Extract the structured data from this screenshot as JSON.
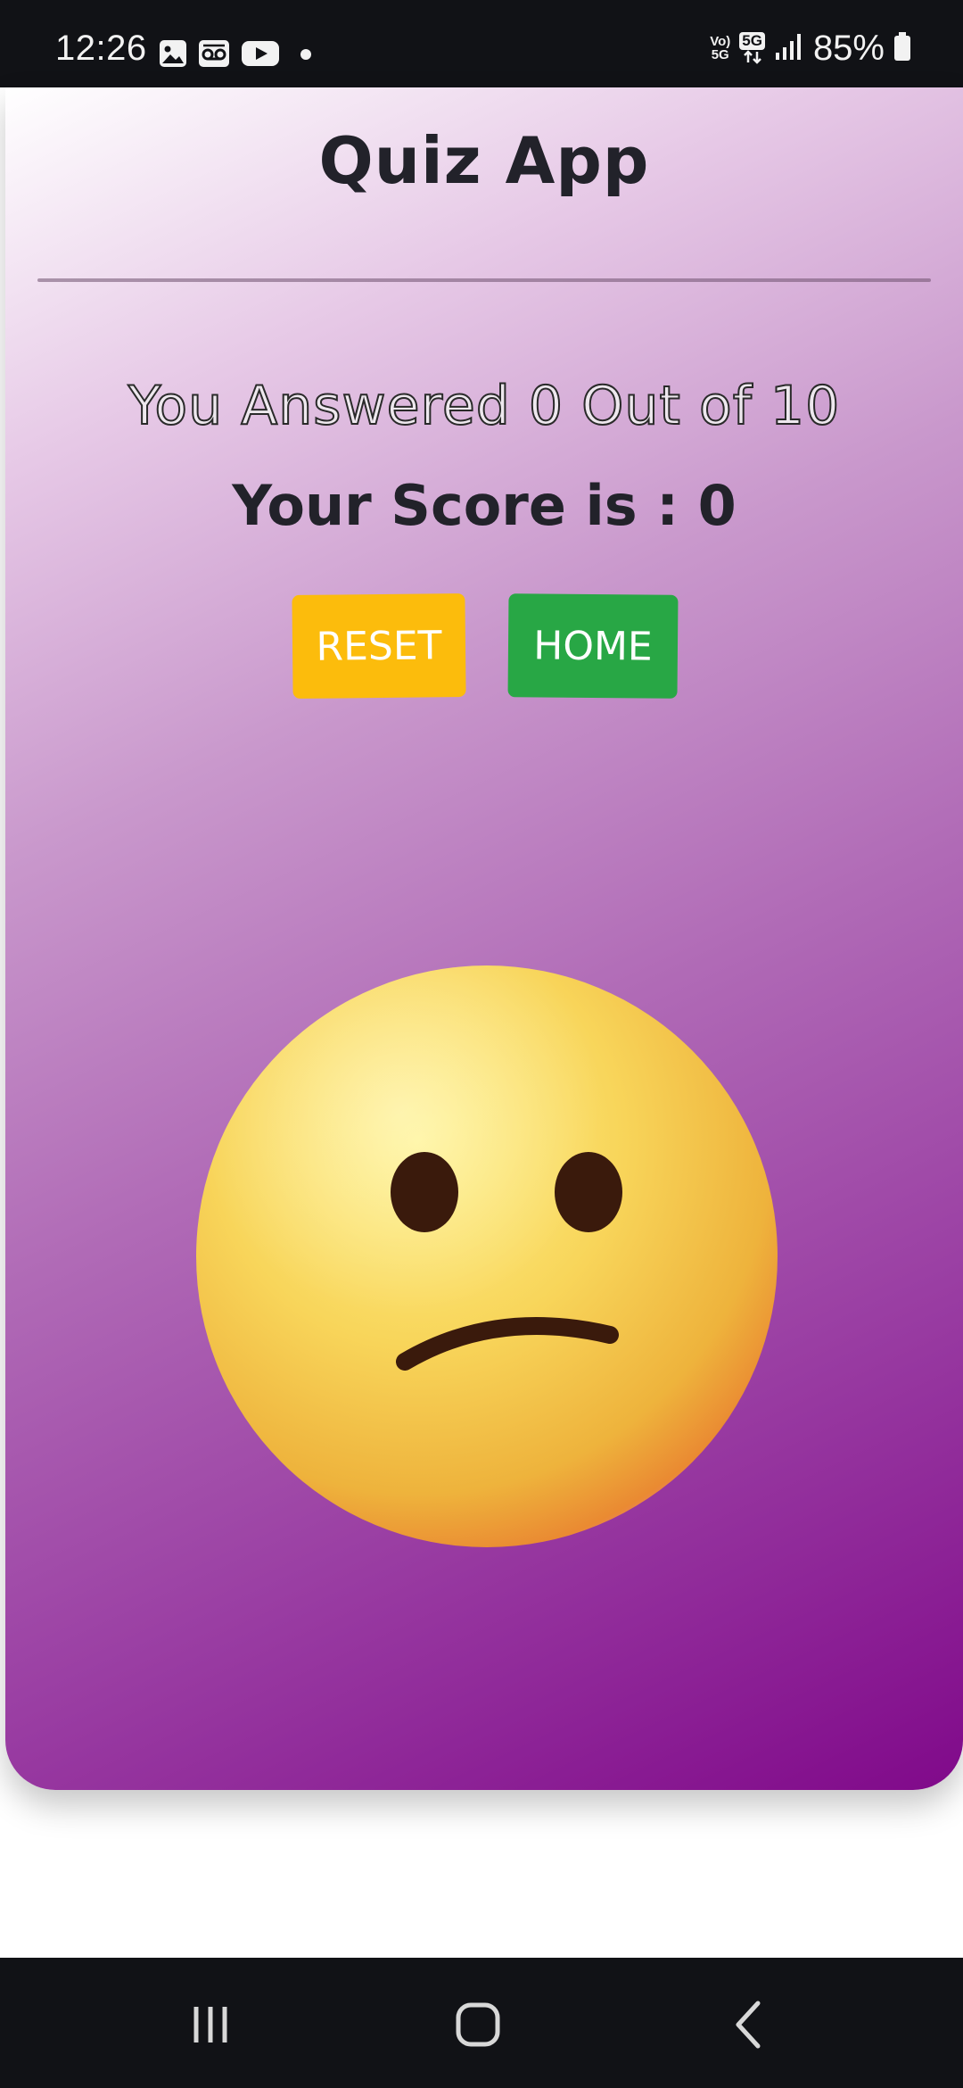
{
  "status_bar": {
    "time": "12:26",
    "battery": "85%",
    "network_top": "Vo)",
    "network_bottom": "5G",
    "data_label": "5G",
    "icons": [
      "gallery-icon",
      "voicemail-icon",
      "youtube-icon",
      "notification-dot-icon",
      "volte-icon",
      "5g-data-icon",
      "signal-icon",
      "battery-icon"
    ]
  },
  "quiz": {
    "title": "Quiz App",
    "answered_text": "You Answered 0 Out of 10",
    "score_text": "Your Score is : 0",
    "answered": 0,
    "total": 10,
    "score": 0,
    "reset_label": "RESET",
    "home_label": "HOME",
    "result_icon": "confused-face-emoji"
  },
  "colors": {
    "reset_button": "#fcbc0c",
    "home_button": "#28a745",
    "gradient_start": "#ffffff",
    "gradient_end": "#80098a"
  },
  "nav_bar": {
    "icons": [
      "recent-apps-icon",
      "home-icon",
      "back-icon"
    ]
  }
}
